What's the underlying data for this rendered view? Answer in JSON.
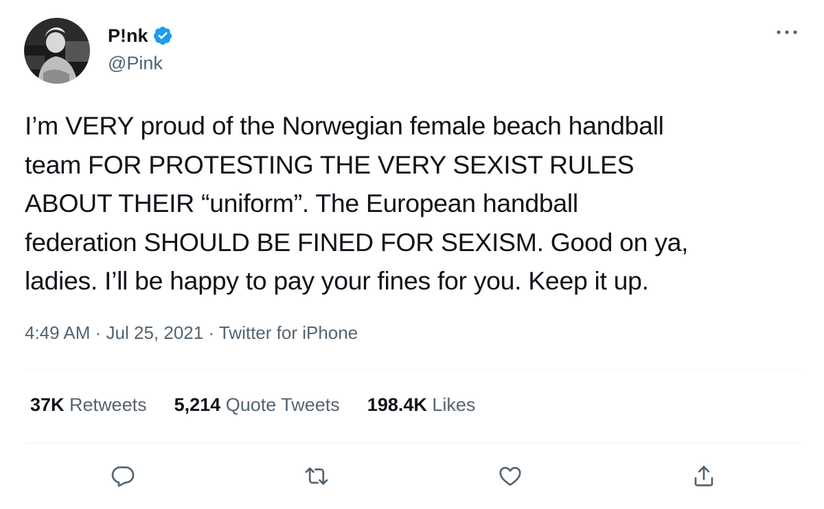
{
  "colors": {
    "text": "#0f1419",
    "secondary": "#536471",
    "divider": "#eff3f4",
    "verified": "#1d9bf0"
  },
  "author": {
    "display_name": "P!nk",
    "handle": "@Pink",
    "verified": true,
    "avatar_icon": "profile-photo"
  },
  "tweet": {
    "text_lines": [
      "I’m VERY proud of the Norwegian female beach handball",
      "team FOR PROTESTING THE VERY SEXIST RULES",
      "ABOUT THEIR “uniform”. The European handball",
      "federation SHOULD BE FINED FOR SEXISM. Good on ya,",
      "ladies. I’ll be happy to pay your fines for you. Keep it up."
    ],
    "time": "4:49 AM",
    "date": "Jul 25, 2021",
    "source": "Twitter for iPhone",
    "separator": "·"
  },
  "stats": {
    "retweets": {
      "count": "37K",
      "label": "Retweets"
    },
    "quotes": {
      "count": "5,214",
      "label": "Quote Tweets"
    },
    "likes": {
      "count": "198.4K",
      "label": "Likes"
    }
  },
  "actions": {
    "icons": [
      "reply-icon",
      "retweet-icon",
      "like-icon",
      "share-icon"
    ]
  }
}
